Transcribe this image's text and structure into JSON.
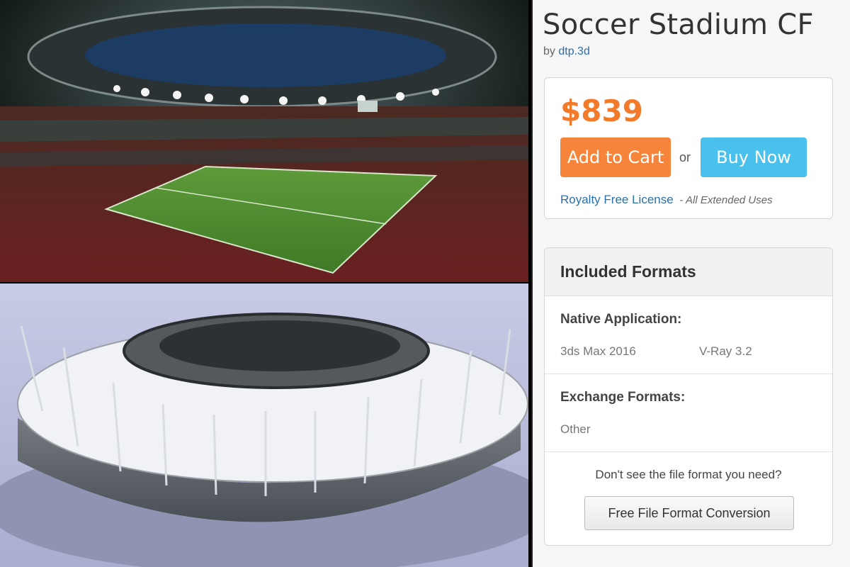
{
  "product": {
    "title": "Soccer Stadium CF",
    "by_prefix": "by",
    "author": "dtp.3d"
  },
  "purchase": {
    "price": "$839",
    "add_to_cart": "Add to Cart",
    "or": "or",
    "buy_now": "Buy Now",
    "license_link": "Royalty Free License",
    "license_note": "- All Extended Uses",
    "colors": {
      "price": "#f47a2b",
      "add_to_cart": "#f6843a",
      "buy_now": "#4ac1ec",
      "link": "#2a6fa8"
    }
  },
  "formats": {
    "header": "Included Formats",
    "native": {
      "heading": "Native Application:",
      "values": [
        "3ds Max 2016",
        "V-Ray 3.2"
      ]
    },
    "exchange": {
      "heading": "Exchange Formats:",
      "values": [
        "Other"
      ]
    },
    "help_text": "Don't see the file format you need?",
    "conversion_button": "Free File Format Conversion"
  },
  "images": {
    "top": "stadium-interior-render",
    "bottom": "stadium-exterior-render"
  }
}
